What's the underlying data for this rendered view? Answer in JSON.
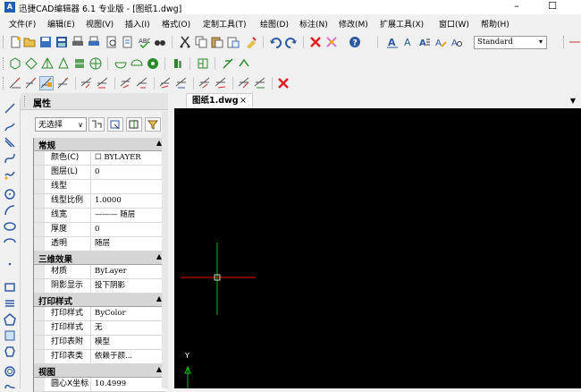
{
  "window": {
    "app_title": "迅捷CAD编辑器 6.1 专业版  - [图纸1.dwg]",
    "logo_text": "A",
    "minimize_glyph": "–",
    "maximize_glyph": "☐"
  },
  "menu": [
    {
      "label": "文件(F)"
    },
    {
      "label": "编辑(E)"
    },
    {
      "label": "视图(V)"
    },
    {
      "label": "插入(I)"
    },
    {
      "label": "格式(O)"
    },
    {
      "label": "定制工具(T)"
    },
    {
      "label": "绘图(D)"
    },
    {
      "label": "标注(N)"
    },
    {
      "label": "修改(M)"
    },
    {
      "label": "扩展工具(X)"
    },
    {
      "label": "窗口(W)"
    },
    {
      "label": "帮助(H)"
    }
  ],
  "toolbar": {
    "text_style_value": "Standard",
    "text_style_arrow": "▾"
  },
  "properties": {
    "title": "属性",
    "selection_value": "无选择",
    "selection_arrow": "∨",
    "sections": [
      {
        "title": "常规",
        "collapse": "▲",
        "rows": [
          {
            "key": "颜色(C)",
            "value": "☐ BYLAYER"
          },
          {
            "key": "图层(L)",
            "value": "0"
          },
          {
            "key": "线型",
            "value": ""
          },
          {
            "key": "线型比例",
            "value": "1.0000"
          },
          {
            "key": "线宽",
            "value": "——— 随层"
          },
          {
            "key": "厚度",
            "value": "0"
          },
          {
            "key": "透明",
            "value": "随层"
          }
        ]
      },
      {
        "title": "三维效果",
        "collapse": "▲",
        "rows": [
          {
            "key": "材质",
            "value": "ByLayer"
          },
          {
            "key": "阴影显示",
            "value": "投下阴影"
          }
        ]
      },
      {
        "title": "打印样式",
        "collapse": "▲",
        "rows": [
          {
            "key": "打印样式",
            "value": "ByColor"
          },
          {
            "key": "打印样式表",
            "value": "无"
          },
          {
            "key": "打印表附加到",
            "value": "模型"
          },
          {
            "key": "打印表类型",
            "value": "依赖于颜..."
          }
        ]
      },
      {
        "title": "视图",
        "collapse": "▲",
        "rows": [
          {
            "key": "圆心X坐标",
            "value": "10.4999"
          }
        ]
      }
    ]
  },
  "tabs": [
    {
      "label": "图纸1.dwg",
      "close": "×"
    }
  ],
  "tab_dropdown": "▼",
  "canvas": {
    "ucs_y_label": "Y",
    "background": "#000000",
    "crosshair_x_color": "#ff0000",
    "crosshair_y_color": "#00c000"
  }
}
